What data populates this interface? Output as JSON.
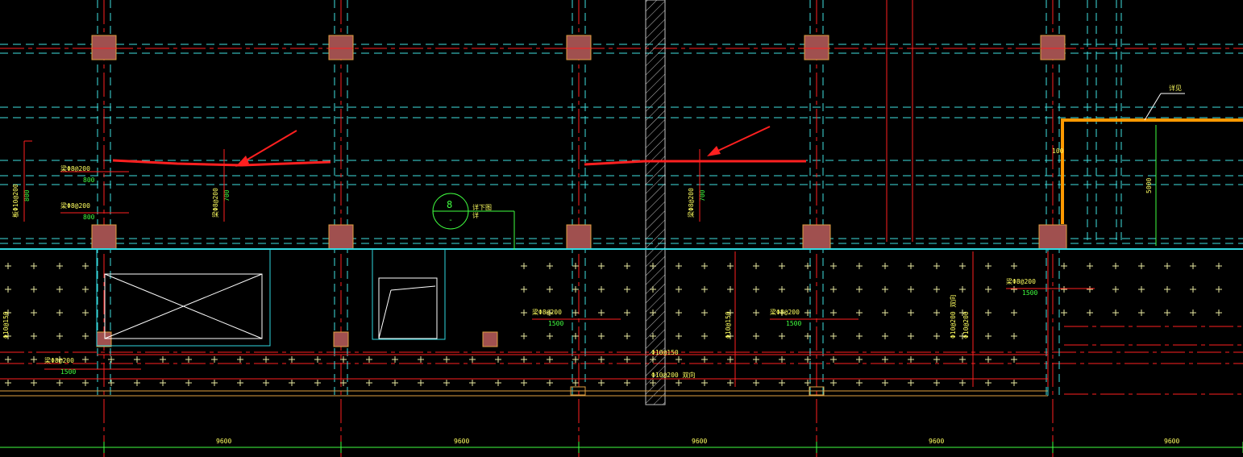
{
  "drawing": {
    "background": "#000000",
    "colors": {
      "axis": "#ff2020",
      "dashed": "#40e0e0",
      "cyan": "#30d8e0",
      "column_fill": "#a0504f",
      "column_edge": "#e0a040",
      "yellow_text": "#ffff60",
      "green_text": "#40ff40",
      "white": "#ffffff",
      "orange": "#ff9900",
      "arrow": "#ff2020",
      "hatch": "#c0c0c0"
    },
    "rebar_labels": [
      {
        "text": "梁Φ8@200",
        "dim": "800"
      },
      {
        "text": "梁Φ8@200",
        "dim": "800"
      },
      {
        "text": "板Φ10@200",
        "dim": "800"
      },
      {
        "text": "梁Φ8@200",
        "dim": "700"
      },
      {
        "text": "梁Φ8@200",
        "dim": "700"
      },
      {
        "text": "梁Φ8@200",
        "dim": "1500"
      },
      {
        "text": "梁Φ8@200",
        "dim": "1500"
      },
      {
        "text": "梁Φ8@200",
        "dim": "1500"
      },
      {
        "text": "梁Φ8@200",
        "dim": "1500"
      }
    ],
    "detail_marker": {
      "number": "8",
      "sub": "-",
      "note": "详下图",
      "note2": "详"
    },
    "side_labels": [
      "Φ10@150",
      "Φ10@150",
      "Φ10@200",
      "Φ10@150",
      "Φ10@200 双向",
      "Φ10@200 双向"
    ],
    "callout": {
      "text": "详见",
      "dim_v": "5000",
      "dim_small": "100"
    },
    "bottom_dims": [
      "9600",
      "9600",
      "9600",
      "9600",
      "9600"
    ]
  }
}
